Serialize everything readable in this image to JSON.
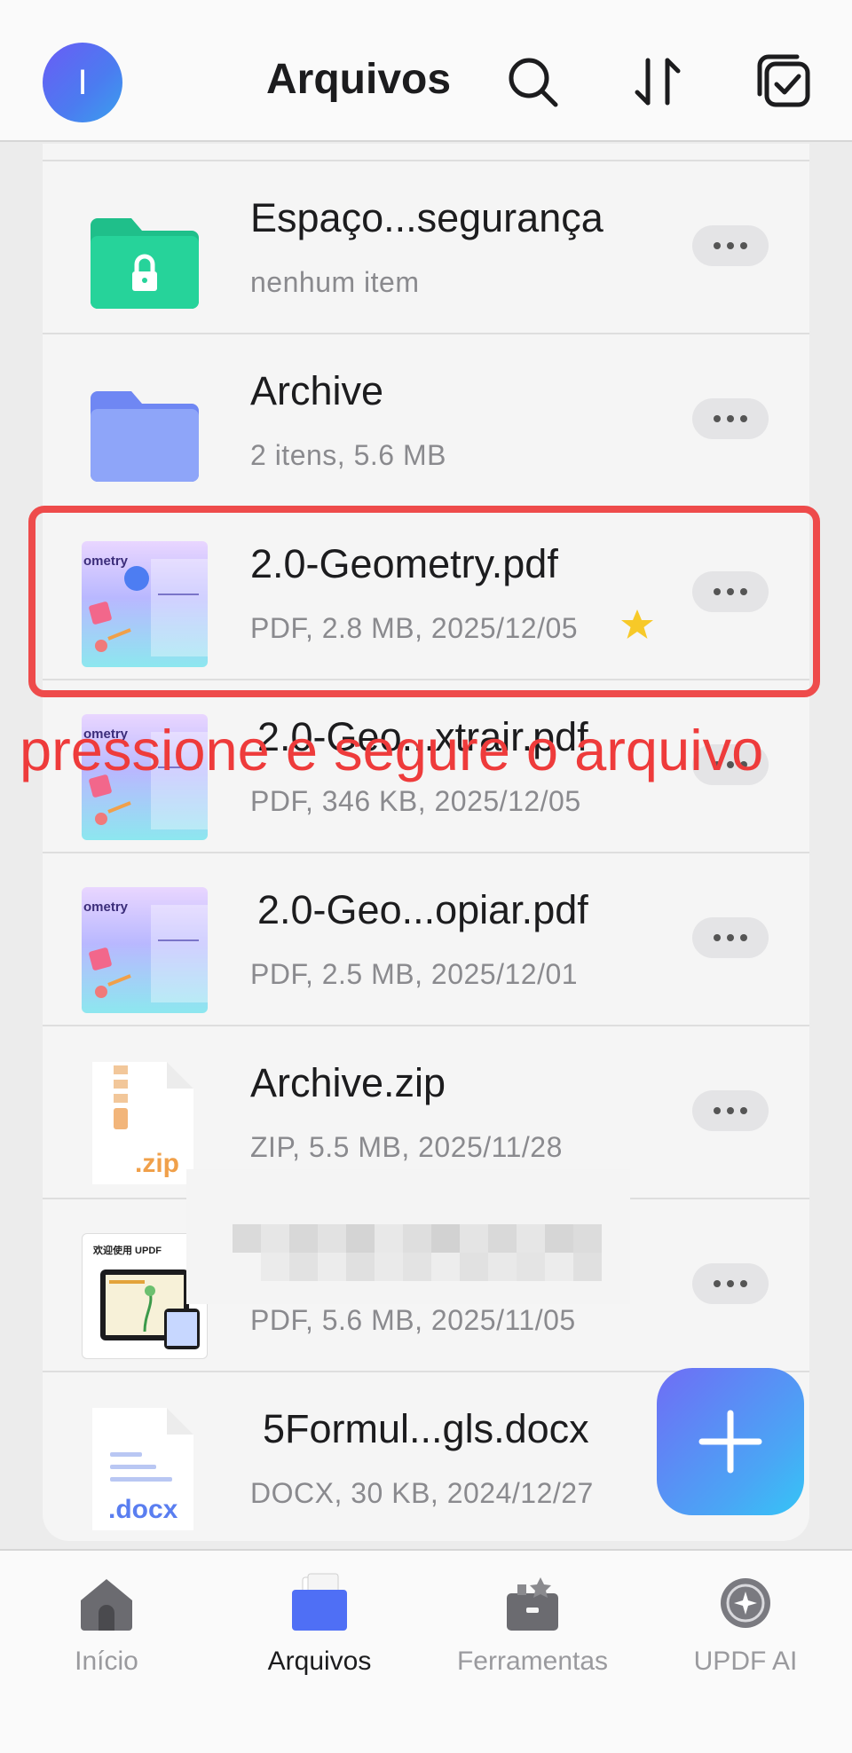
{
  "header": {
    "avatar_initial": "I",
    "title": "Arquivos",
    "icons": [
      "search-icon",
      "sort-icon",
      "select-icon"
    ]
  },
  "files": [
    {
      "name": "Espaço...segurança",
      "meta": "nenhum item",
      "type": "secure-folder",
      "starred": false
    },
    {
      "name": "Archive",
      "meta": "2 itens, 5.6 MB",
      "type": "folder",
      "starred": false
    },
    {
      "name": "2.0-Geometry.pdf",
      "meta": "PDF, 2.8 MB, 2025/12/05",
      "type": "pdf",
      "starred": true,
      "thumb_text": "ometry"
    },
    {
      "name": "2.0-Geo...xtrair.pdf",
      "meta": "PDF, 346 KB, 2025/12/05",
      "type": "pdf",
      "starred": false,
      "thumb_text": "ometry"
    },
    {
      "name": "2.0-Geo...opiar.pdf",
      "meta": "PDF, 2.5 MB, 2025/12/01",
      "type": "pdf",
      "starred": false,
      "thumb_text": "ometry"
    },
    {
      "name": "Archive.zip",
      "meta": "ZIP, 5.5 MB, 2025/11/28",
      "type": "zip",
      "starred": false,
      "ext_label": ".zip"
    },
    {
      "name": "",
      "meta": "PDF, 5.6 MB, 2025/11/05",
      "type": "pdf-updf",
      "starred": false,
      "thumb_text": "欢迎使用 UPDF"
    },
    {
      "name": "5Formul...gls.docx",
      "meta": "DOCX, 30 KB, 2024/12/27",
      "type": "docx",
      "starred": false,
      "ext_label": ".docx"
    }
  ],
  "annotation": {
    "hint_text": "pressione e segure o arquivo",
    "color": "#ee4b4b"
  },
  "tabs": [
    {
      "label": "Início",
      "icon": "home-icon",
      "active": false
    },
    {
      "label": "Arquivos",
      "icon": "folder-icon",
      "active": true
    },
    {
      "label": "Ferramentas",
      "icon": "toolbox-icon",
      "active": false
    },
    {
      "label": "UPDF AI",
      "icon": "ai-icon",
      "active": false
    }
  ],
  "colors": {
    "accent": "#4f6ff5",
    "folder_green": "#1fc48c",
    "folder_blue": "#7d95f7",
    "star": "#f7c928"
  }
}
